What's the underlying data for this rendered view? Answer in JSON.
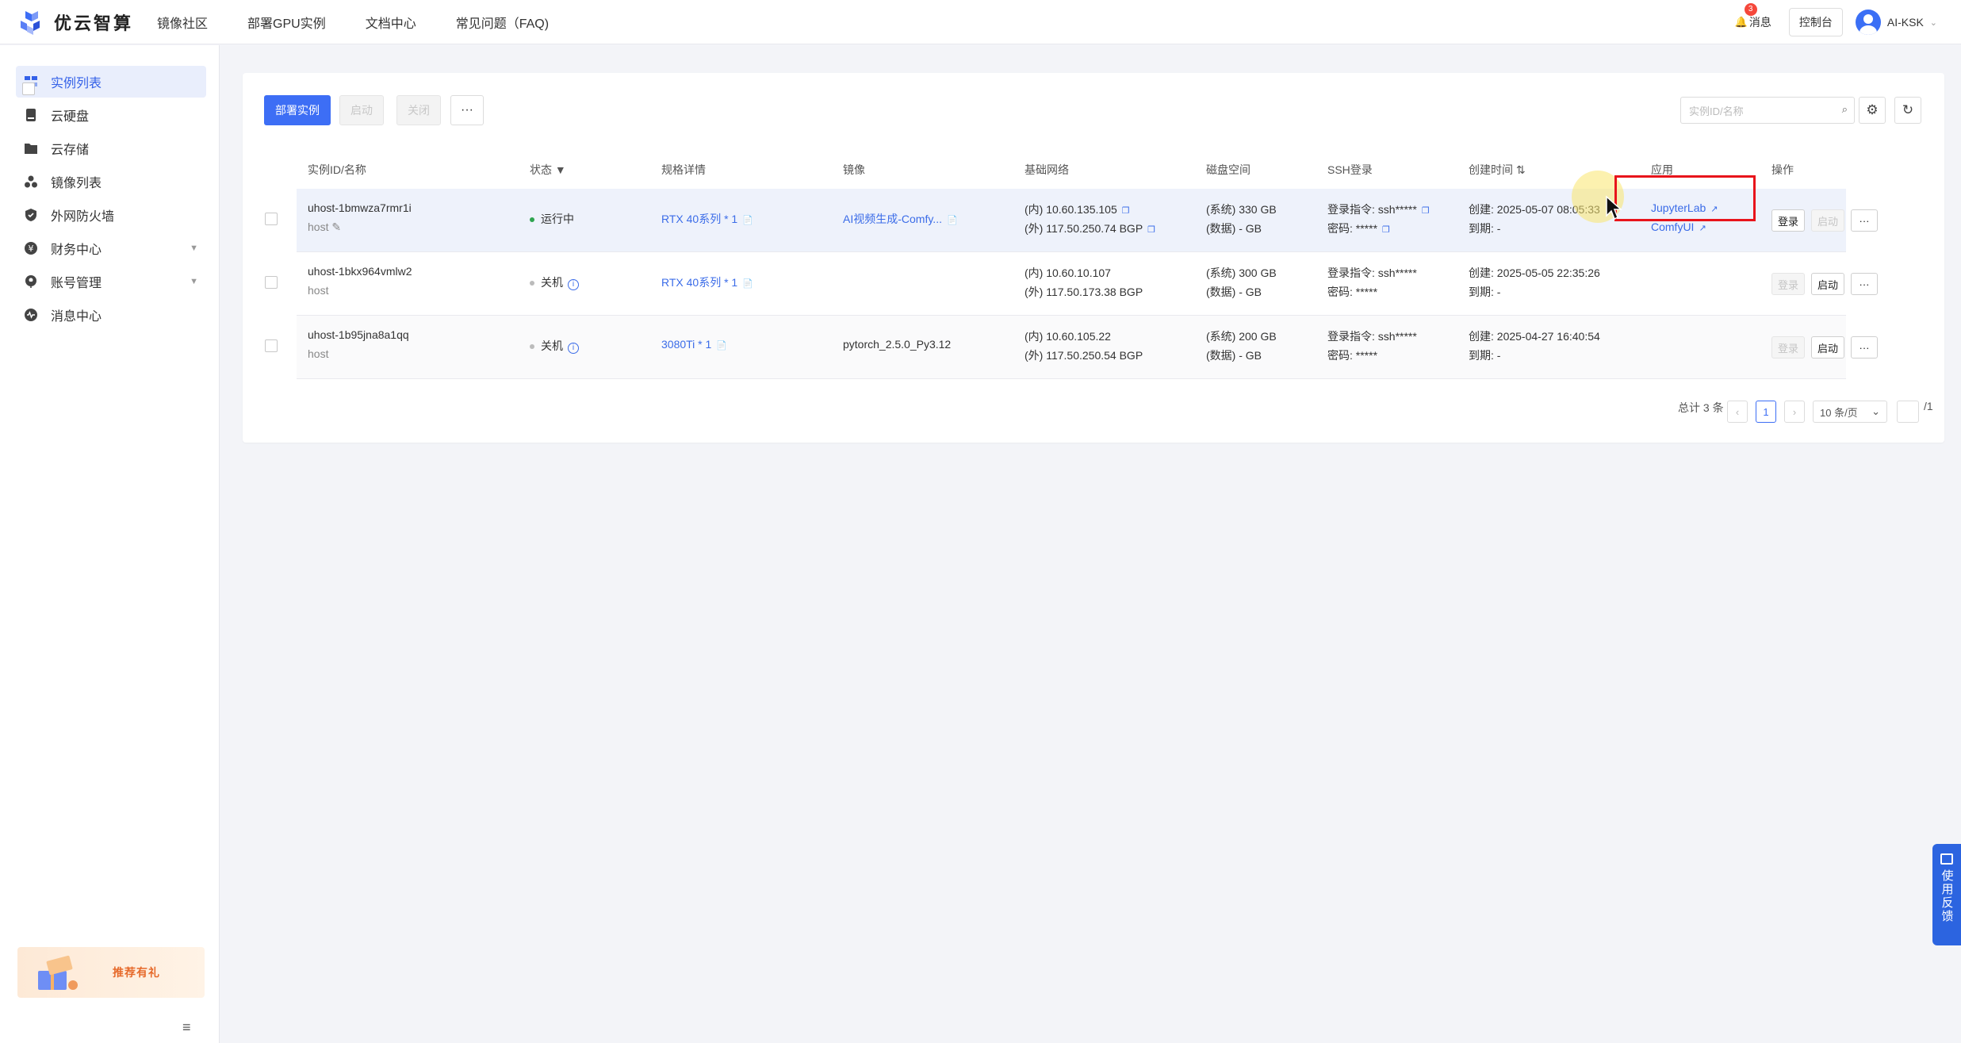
{
  "brand": {
    "name": "优云智算"
  },
  "nav": [
    {
      "label": "镜像社区"
    },
    {
      "label": "部署GPU实例"
    },
    {
      "label": "文档中心"
    },
    {
      "label": "常见问题（FAQ)"
    }
  ],
  "header": {
    "messages_label": "消息",
    "messages_badge": "3",
    "console_label": "控制台",
    "user_name": "AI-KSK"
  },
  "sidebar": {
    "items": [
      {
        "label": "实例列表",
        "icon": "instance-list-icon",
        "active": true
      },
      {
        "label": "云硬盘",
        "icon": "disk-icon"
      },
      {
        "label": "云存储",
        "icon": "storage-folder-icon"
      },
      {
        "label": "镜像列表",
        "icon": "image-cubes-icon"
      },
      {
        "label": "外网防火墙",
        "icon": "shield-icon"
      },
      {
        "label": "财务中心",
        "icon": "finance-icon",
        "expandable": true
      },
      {
        "label": "账号管理",
        "icon": "account-icon",
        "expandable": true
      },
      {
        "label": "消息中心",
        "icon": "message-icon"
      }
    ],
    "promo_label": "推荐有礼"
  },
  "toolbar": {
    "deploy_label": "部署实例",
    "start_label": "启动",
    "stop_label": "关闭",
    "more_label": "···",
    "search_placeholder": "实例ID/名称"
  },
  "table": {
    "columns": {
      "id_name": "实例ID/名称",
      "status": "状态",
      "spec": "规格详情",
      "image": "镜像",
      "network": "基础网络",
      "disk": "磁盘空间",
      "ssh": "SSH登录",
      "created": "创建时间",
      "apps": "应用",
      "actions": "操作"
    },
    "rows": [
      {
        "id": "uhost-1bmwza7rmr1i",
        "name": "host",
        "status": "运行中",
        "spec": "RTX 40系列 * 1",
        "image": "AI视频生成-Comfy...",
        "net_in": "(内) 10.60.135.105",
        "net_out": "(外) 117.50.250.74 BGP",
        "disk_sys": "(系统) 330 GB",
        "disk_data": "(数据) - GB",
        "ssh_cmd_label": "登录指令:",
        "ssh_cmd": "ssh*****",
        "ssh_pwd_label": "密码:",
        "ssh_pwd": "*****",
        "created": "创建: 2025-05-07 08:05:33",
        "expires": "到期: -",
        "app1": "JupyterLab",
        "app2": "ComfyUI",
        "login": "登录",
        "start": "启动",
        "more": "···"
      },
      {
        "id": "uhost-1bkx964vmlw2",
        "name": "host",
        "status": "关机",
        "spec": "RTX 40系列 * 1",
        "image": "",
        "net_in": "(内) 10.60.10.107",
        "net_out": "(外) 117.50.173.38 BGP",
        "disk_sys": "(系统) 300 GB",
        "disk_data": "(数据) - GB",
        "ssh_cmd_label": "登录指令:",
        "ssh_cmd": "ssh*****",
        "ssh_pwd_label": "密码:",
        "ssh_pwd": "*****",
        "created": "创建: 2025-05-05 22:35:26",
        "expires": "到期: -",
        "login": "登录",
        "start": "启动",
        "more": "···"
      },
      {
        "id": "uhost-1b95jna8a1qq",
        "name": "host",
        "status": "关机",
        "spec": "3080Ti * 1",
        "image": "pytorch_2.5.0_Py3.12",
        "net_in": "(内) 10.60.105.22",
        "net_out": "(外) 117.50.250.54 BGP",
        "disk_sys": "(系统) 200 GB",
        "disk_data": "(数据) - GB",
        "ssh_cmd_label": "登录指令:",
        "ssh_cmd": "ssh*****",
        "ssh_pwd_label": "密码:",
        "ssh_pwd": "*****",
        "created": "创建: 2025-04-27 16:40:54",
        "expires": "到期: -",
        "login": "登录",
        "start": "启动",
        "more": "···"
      }
    ]
  },
  "pagination": {
    "total": "总计 3 条",
    "current_page": "1",
    "page_size": "10 条/页",
    "total_pages": "/1"
  },
  "feedback_label": "使用反馈",
  "colors": {
    "primary": "#3d6ef5",
    "running": "#2ea44f",
    "highlight": "#e8141b"
  }
}
